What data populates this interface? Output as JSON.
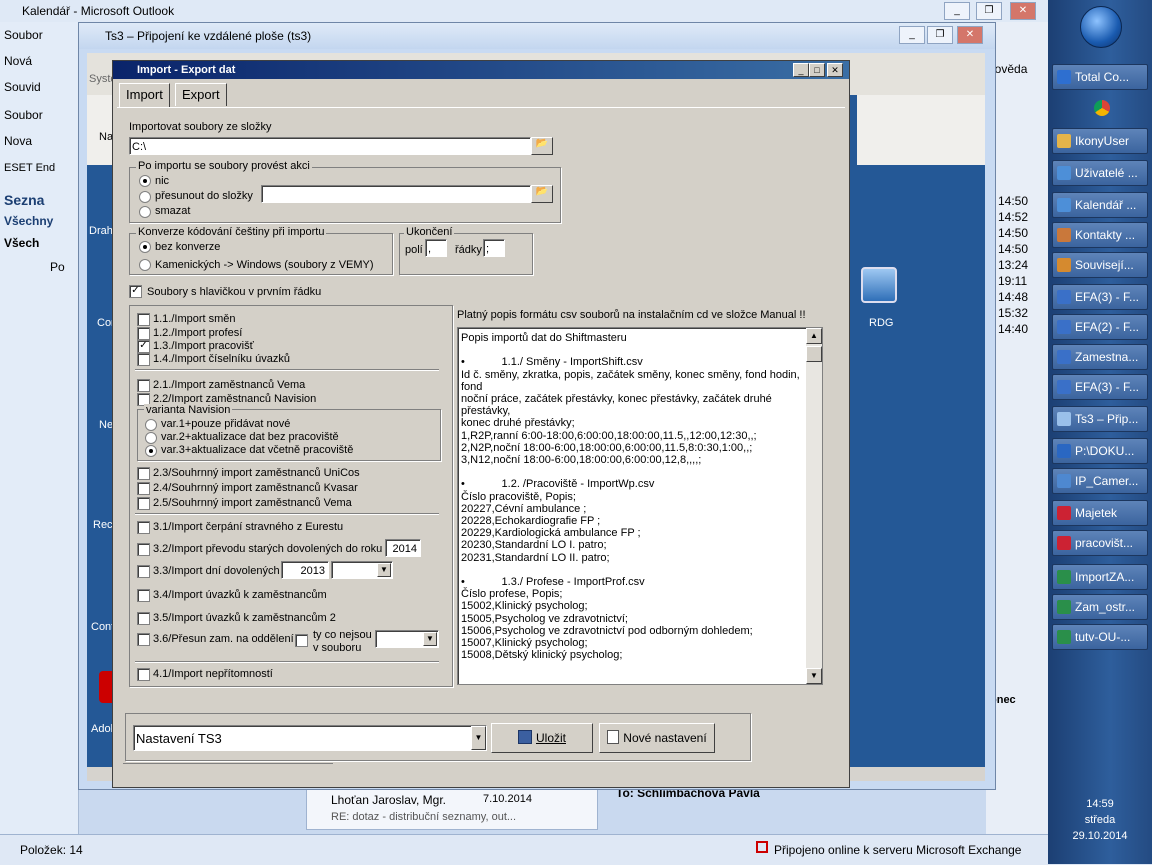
{
  "outlook": {
    "title": "Kalendář - Microsoft Outlook",
    "menu": [
      "Soubor",
      "Nová",
      "Souvid",
      "Soubor",
      "Nova",
      "ESET End",
      "Sezna",
      "Všechny",
      "Všech",
      "Po"
    ],
    "status_left": "Položek: 14",
    "status_right": "Připojeno online k serveru Microsoft Exchange",
    "help": "povědа",
    "times": [
      "14:50",
      "14:52",
      "14:50",
      "14:50",
      "13:24",
      "19:11",
      "14:48",
      "15:32",
      "14:40"
    ],
    "mail_from": "Lhoťan Jaroslav, Mgr.",
    "mail_date": "7.10.2014",
    "mail_subject": "RE: dotaz - distribuční seznamy, out...",
    "mail_to": "To: Schlimbachova Pavla",
    "right_label": "onec"
  },
  "taskbar": {
    "items": [
      "Total Co...",
      "IkonyUser",
      "Uživatelé ...",
      "Kalendář ...",
      "Kontakty ...",
      "Souvisejí...",
      "EFA(3) - F...",
      "EFA(2) - F...",
      "Zamestna...",
      "EFA(3) - F...",
      "Ts3 – Přip...",
      "P:\\DOKU...",
      "IP_Camer...",
      "Majetek",
      "pracovišt...",
      "ImportZA...",
      "Zam_ostr...",
      "tutv-OU-..."
    ],
    "time": "14:59",
    "day": "středa",
    "date": "29.10.2014"
  },
  "rdp": {
    "title": "Ts3 – Připojení ke vzdálené ploše (ts3)",
    "inner_menu": "Systé",
    "left_labels": [
      "Na",
      "Drahol",
      "Con",
      "Ne",
      "Recy",
      "Cont",
      "Adobe"
    ],
    "rdg_label": "RDG"
  },
  "dialog": {
    "title": "Import - Export dat",
    "tabs": [
      "Import",
      "Export"
    ],
    "folder_label": "Importovat soubory ze složky",
    "folder_value": "C:\\",
    "after_import_label": "Po importu se soubory provést akci",
    "after_options": [
      "nic",
      "přesunout do složky",
      "smazat"
    ],
    "encoding_label": "Konverze kódování češtiny při importu",
    "encoding_options": [
      "bez konverze",
      "Kamenických -> Windows  (soubory z VEMY)"
    ],
    "end_label": "Ukončení",
    "end_fields_label": "polí",
    "end_fields_value": ",",
    "end_rows_label": "řádky",
    "end_rows_value": ";",
    "header_checkbox": "Soubory s hlavičkou v prvním řádku",
    "info_text": "Platný popis formátu csv souborů na instalačním cd ve složce Manual !!",
    "imports_a": [
      "1.1./Import směn",
      "1.2./Import profesí",
      "1.3./Import pracovišť",
      "1.4./Import číselníku úvazků"
    ],
    "imports_b": [
      "2.1./Import zaměstnanců Vema",
      "2.2/Import zaměstnanců  Navision"
    ],
    "navision_label": "varianta Navision",
    "navision_options": [
      "var.1+pouze přidávat nové",
      "var.2+aktualizace dat bez pracoviště",
      "var.3+aktualizace dat včetně pracoviště"
    ],
    "imports_c": [
      "2.3/Souhrnný import zaměstnanců  UniCos",
      "2.4/Souhrnný import zaměstnanců Kvasar",
      "2.5/Souhrnný import zaměstnanců Vema"
    ],
    "import_31": "3.1/Import čerpání stravného z Eurestu",
    "import_32": "3.2/Import převodu starých dovolených do roku",
    "import_32_year": "2014",
    "import_33": "3.3/Import dní dovolených",
    "import_33_year": "2013",
    "import_34": "3.4/Import úvazků k zaměstnancům",
    "import_35": "3.5/Import úvazků k zaměstnancům 2",
    "import_36": "3.6/Přesun zam. na oddělení",
    "import_36_sub": "ty co nejsou",
    "import_36_sub2": "v souboru",
    "import_41": "4.1/Import nepřítomností",
    "settings_value": "Nastavení TS3",
    "save_button": "Uložit",
    "new_button": "Nové nastavení",
    "memo_text": "Popis importů dat do Shiftmasteru\n\n•            1.1./ Směny - ImportShift.csv\nId č. směny, zkratka, popis, začátek směny, konec směny, fond hodin, fond\nnoční práce, začátek přestávky, konec přestávky, začátek druhé přestávky,\nkonec druhé přestávky;\n1,R2P,ranní 6:00-18:00,6:00:00,18:00:00,11.5,,12:00,12:30,,;\n2,N2P,noční 18:00-6:00,18:00:00,6:00:00,11.5,8:0:30,1:00,,;\n3,N12,noční 18:00-6:00,18:00:00,6:00:00,12,8,,,,;\n\n•            1.2. /Pracoviště - ImportWp.csv\nČíslo pracoviště, Popis;\n20227,Cévní ambulance ;\n20228,Echokardiografie FP ;\n20229,Kardiologická ambulance FP ;\n20230,Standardní LO I. patro;\n20231,Standardní LO II. patro;\n\n•            1.3./ Profese - ImportProf.csv\nČíslo profese, Popis;\n15002,Klinický psycholog;\n15005,Psycholog ve zdravotnictví;\n15006,Psycholog ve zdravotnictví pod odborným dohledem;\n15007,Klinický psycholog;\n15008,Dětský klinický psycholog;"
  }
}
